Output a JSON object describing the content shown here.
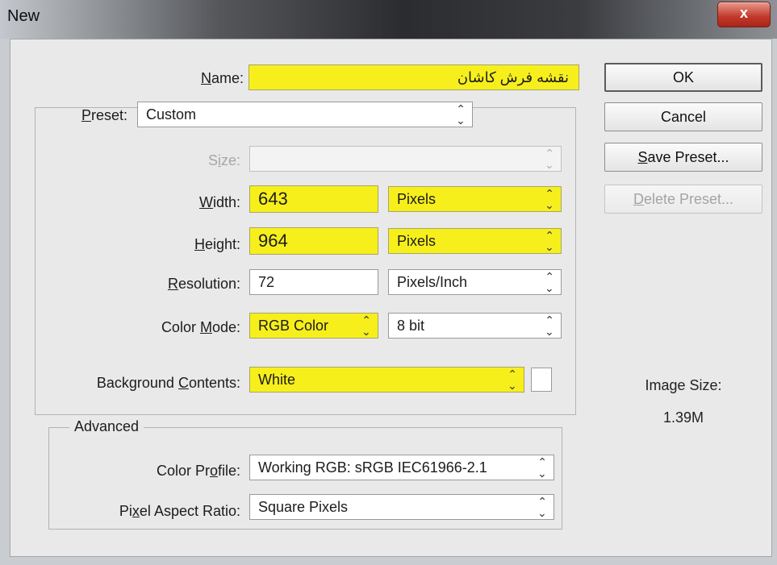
{
  "window": {
    "title": "New",
    "close_glyph": "x"
  },
  "name": {
    "label": "Name:",
    "value": "نقشه فرش کاشان"
  },
  "preset": {
    "label": "Preset:",
    "value": "Custom"
  },
  "size": {
    "label": "Size:",
    "value": ""
  },
  "width": {
    "label": "Width:",
    "value": "643",
    "unit": "Pixels"
  },
  "height": {
    "label": "Height:",
    "value": "964",
    "unit": "Pixels"
  },
  "resolution": {
    "label": "Resolution:",
    "value": "72",
    "unit": "Pixels/Inch"
  },
  "color_mode": {
    "label": "Color Mode:",
    "value": "RGB Color",
    "bit_depth": "8 bit"
  },
  "background_contents": {
    "label": "Background Contents:",
    "value": "White",
    "swatch_color": "#ffffff"
  },
  "advanced": {
    "title": "Advanced",
    "color_profile": {
      "label": "Color Profile:",
      "value": "Working RGB:  sRGB IEC61966-2.1"
    },
    "pixel_aspect_ratio": {
      "label": "Pixel Aspect Ratio:",
      "value": "Square Pixels"
    }
  },
  "buttons": {
    "ok": "OK",
    "cancel": "Cancel",
    "save_preset": "Save Preset...",
    "delete_preset": "Delete Preset..."
  },
  "image_size": {
    "label": "Image Size:",
    "value": "1.39M"
  },
  "icons": {
    "dropdown": "updown-chevron-icon",
    "close": "close-icon"
  },
  "colors": {
    "highlight": "#f7ef1c",
    "dialog_bg": "#e9e9e9",
    "close_button": "#c1382a"
  }
}
